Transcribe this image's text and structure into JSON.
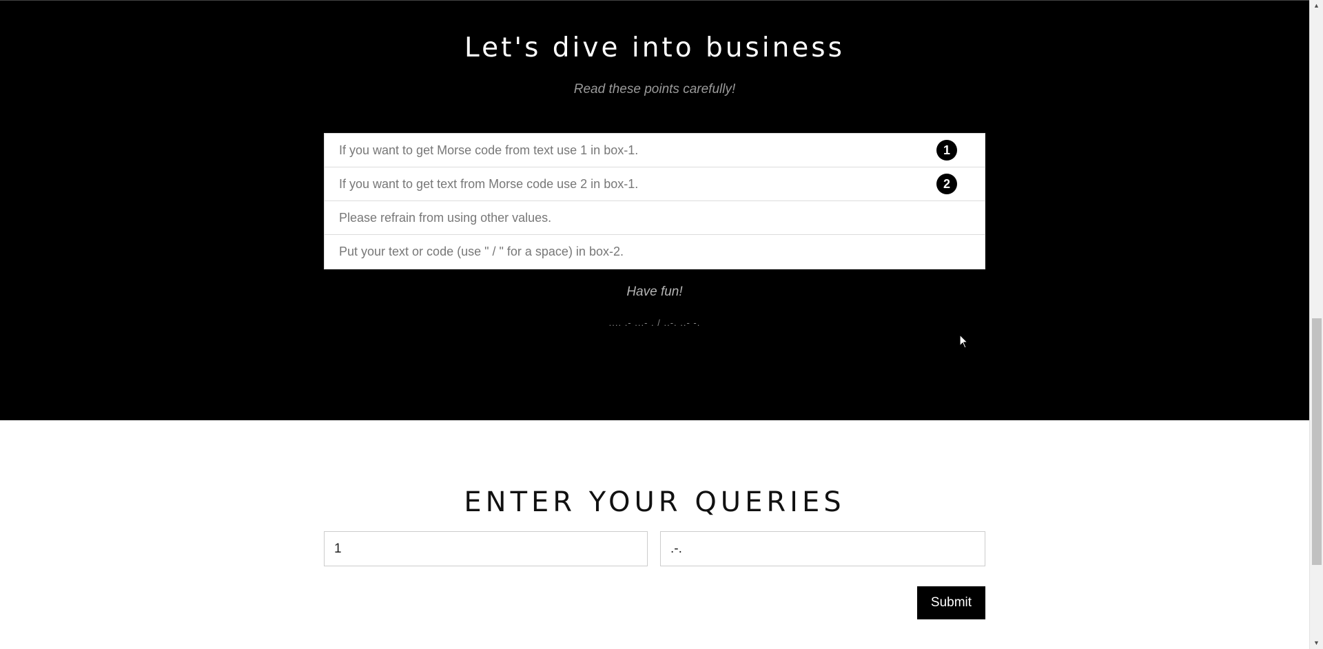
{
  "hero": {
    "heading": "Let's dive into business",
    "subheading": "Read these points carefully!",
    "points": [
      {
        "text": "If you want to get Morse code from text use 1 in box-1.",
        "badge": "1"
      },
      {
        "text": "If you want to get text from Morse code use 2 in box-1.",
        "badge": "2"
      },
      {
        "text": "Please refrain from using other values.",
        "badge": ""
      },
      {
        "text": "Put your text or code (use \" / \" for a space) in box-2.",
        "badge": ""
      }
    ],
    "closing": "Have fun!",
    "morse": ".... .- ...- . / ..-. ..- -."
  },
  "queries": {
    "title": "ENTER YOUR QUERIES",
    "box1_value": "1",
    "box2_value": ".-.",
    "submit_label": "Submit"
  },
  "icons": {
    "cursor": "mouse-pointer-icon",
    "scroll_up": "chevron-up-icon",
    "scroll_down": "chevron-down-icon"
  },
  "colors": {
    "dark_bg": "#000000",
    "badge_bg": "#000000",
    "submit_bg": "#000000"
  }
}
